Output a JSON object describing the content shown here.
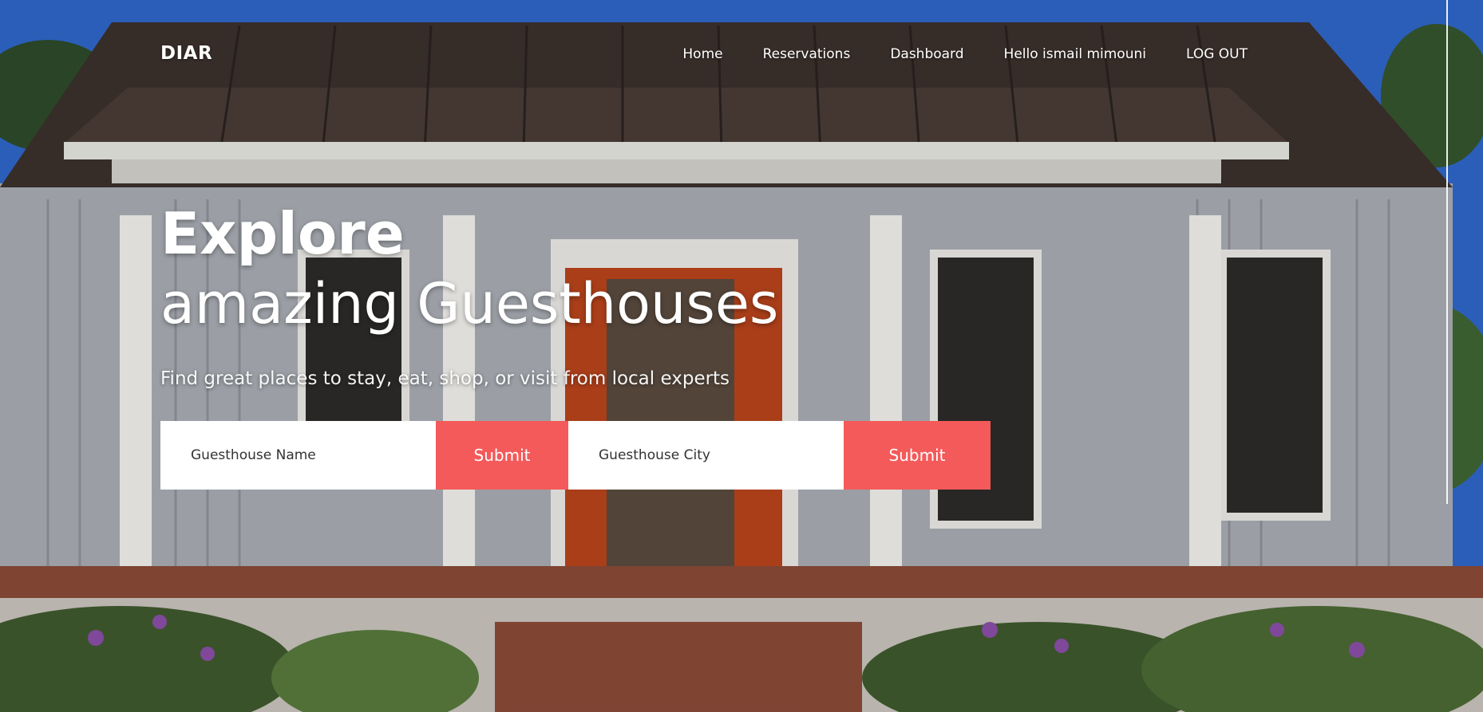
{
  "brand": "DIAR",
  "nav": {
    "home": "Home",
    "reservations": "Reservations",
    "dashboard": "Dashboard",
    "greeting": "Hello ismail mimouni",
    "logout": "LOG OUT"
  },
  "hero": {
    "title_strong": "Explore",
    "title_light": "amazing Guesthouses",
    "subtitle": "Find great places to stay, eat, shop, or visit from local experts"
  },
  "search": {
    "name_placeholder": "Guesthouse Name",
    "name_submit": "Submit",
    "city_placeholder": "Guesthouse City",
    "city_submit": "Submit"
  },
  "colors": {
    "accent": "#f45a5a",
    "sky": "#2f66c8",
    "roof": "#3b302c",
    "siding": "#a9adb4",
    "door": "#b8441c"
  }
}
